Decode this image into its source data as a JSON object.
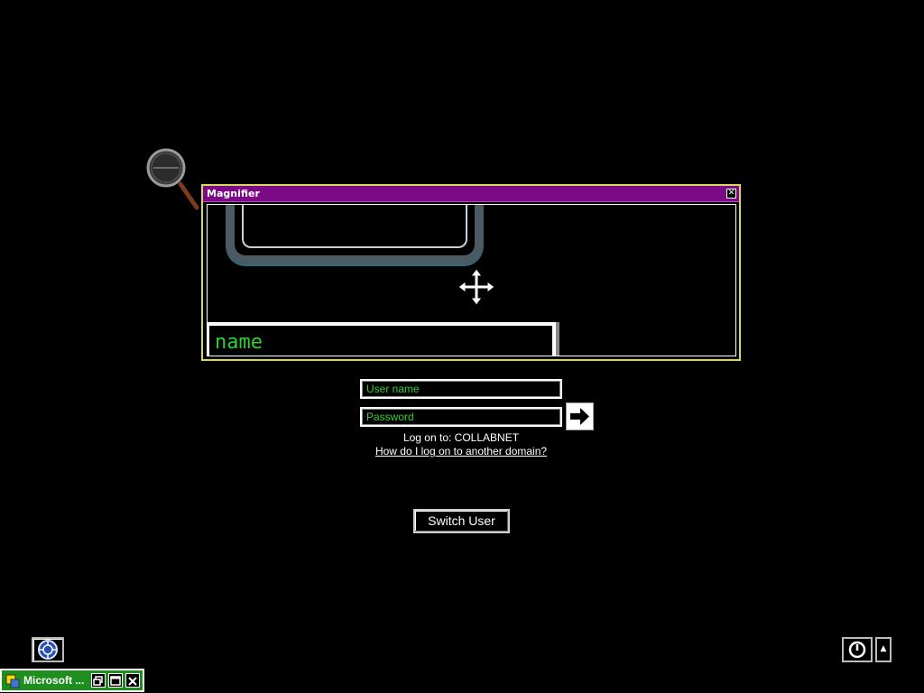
{
  "magnifier": {
    "title": "Magnifier",
    "close_glyph": "✕",
    "magnified_text": "name",
    "icons": [
      "magnifier-lens-icon",
      "move-cursor-icon"
    ]
  },
  "logon": {
    "username_placeholder": "User name",
    "password_placeholder": "Password",
    "logon_to": "Log on to: COLLABNET",
    "help_link": "How do I log on to another domain?",
    "switch_user": "Switch User"
  },
  "controls": {
    "accessibility_icon": "accessibility-icon",
    "power_icon": "power-icon",
    "power_options_glyph": "▲"
  },
  "taskbar": {
    "item_label": "Microsoft ...",
    "buttons": [
      "restore-icon",
      "maximize-icon",
      "close-icon"
    ]
  },
  "colors": {
    "background": "#000000",
    "magnifier_title_bar": "#7c0a87",
    "magnifier_border": "#d8d860",
    "input_text": "#2fd12f",
    "taskbar_item": "#1e8f1e"
  }
}
